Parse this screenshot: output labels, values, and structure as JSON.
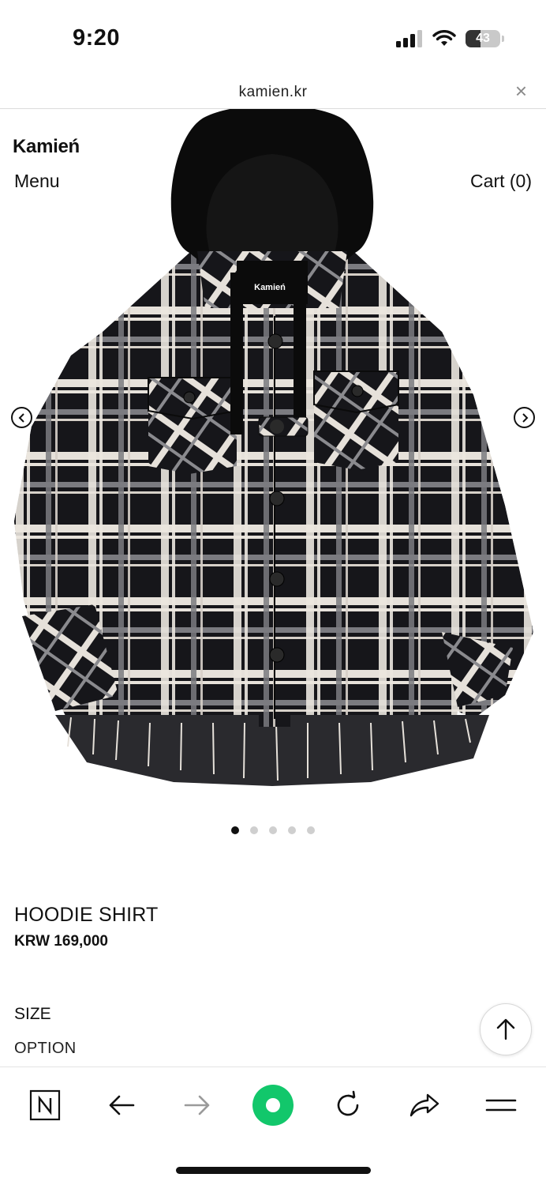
{
  "status_bar": {
    "time": "9:20",
    "battery": "43"
  },
  "browser": {
    "url": "kamien.kr",
    "close_symbol": "×"
  },
  "site": {
    "brand": "Kamień",
    "menu_label": "Menu",
    "cart_label": "Cart (0)"
  },
  "product": {
    "label_on_garment": "Kamień",
    "name": "HOODIE SHIRT",
    "price": "KRW 169,000",
    "image_count": 5,
    "active_image": 1,
    "size_label": "SIZE",
    "option_label": "OPTION"
  },
  "colors": {
    "accent_green": "#12c76b",
    "text": "#111111"
  },
  "toolbar_icons": [
    "naver-n-icon",
    "back-arrow-icon",
    "forward-arrow-icon",
    "green-dot-icon",
    "reload-icon",
    "share-icon",
    "hamburger-menu-icon"
  ]
}
